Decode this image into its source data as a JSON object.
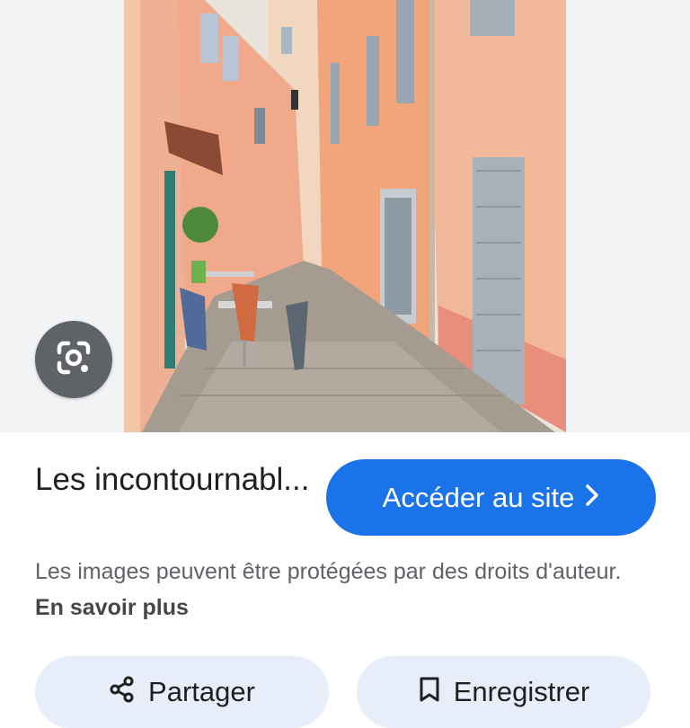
{
  "result": {
    "title": "Les incontournabl...",
    "visit_button_label": "Accéder au site",
    "visit_button_icon": "chevron-right-icon",
    "copyright_notice": "Les images peuvent être protégées par des droits d'auteur.",
    "learn_more_label": "En savoir plus"
  },
  "actions": {
    "share_label": "Partager",
    "share_icon": "share-icon",
    "save_label": "Enregistrer",
    "save_icon": "bookmark-icon"
  },
  "lens": {
    "icon": "google-lens-icon"
  },
  "colors": {
    "accent": "#1a73e8",
    "chip_background": "#e8eef9",
    "band_background": "#f1f3f4"
  }
}
